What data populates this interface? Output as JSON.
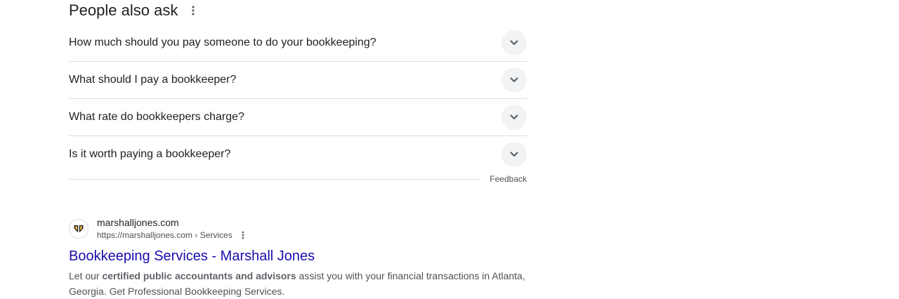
{
  "paa": {
    "title": "People also ask",
    "questions": [
      "How much should you pay someone to do your bookkeeping?",
      "What should I pay a bookkeeper?",
      "What rate do bookkeepers charge?",
      "Is it worth paying a bookkeeper?"
    ],
    "feedback_label": "Feedback",
    "icons": {
      "menu": "more-vert-icon",
      "expand": "chevron-down-icon"
    }
  },
  "result": {
    "site_name": "marshalljones.com",
    "url": "https://marshalljones.com › Services",
    "title": "Bookkeeping Services - Marshall Jones",
    "snippet_pre": "Let our ",
    "snippet_bold": "certified public accountants and advisors",
    "snippet_post": " assist you with your financial transactions in Atlanta, Georgia. Get Professional Bookkeeping Services.",
    "favicon": "marshall-jones-logo-icon"
  },
  "colors": {
    "link": "#1a0dab",
    "text": "#202124",
    "muted": "#4d5156",
    "divider": "#dadce0",
    "chevron_bg": "#f1f3f4"
  }
}
